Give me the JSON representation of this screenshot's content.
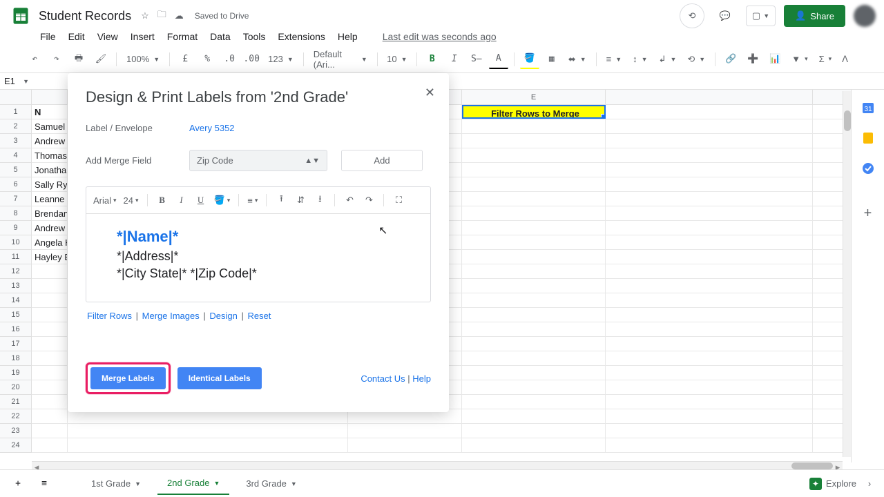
{
  "header": {
    "doc_title": "Student Records",
    "saved": "Saved to Drive",
    "share": "Share"
  },
  "menu": {
    "items": [
      "File",
      "Edit",
      "View",
      "Insert",
      "Format",
      "Data",
      "Tools",
      "Extensions",
      "Help"
    ],
    "last_edit": "Last edit was seconds ago"
  },
  "toolbar": {
    "zoom": "100%",
    "font": "Default (Ari...",
    "font_size": "10"
  },
  "namebox": "E1",
  "columns": {
    "E": "E"
  },
  "rows": {
    "names": [
      "Samuel",
      "Andrew",
      "Thomas",
      "Jonatha",
      "Sally Ry",
      "Leanne",
      "Brendan",
      "Andrew",
      "Angela H",
      "Hayley E"
    ]
  },
  "filter_header": "Filter Rows to Merge",
  "dialog": {
    "title": "Design & Print Labels from '2nd Grade'",
    "label_envelope": "Label / Envelope",
    "avery": "Avery 5352",
    "merge_field_label": "Add Merge Field",
    "merge_field_value": "Zip Code",
    "add": "Add",
    "editor": {
      "font": "Arial",
      "size": "24",
      "line1": "*|Name|*",
      "line2": "*|Address|*",
      "line3": "*|City State|* *|Zip Code|*"
    },
    "links": {
      "filter": "Filter Rows",
      "images": "Merge Images",
      "design": "Design",
      "reset": "Reset"
    },
    "merge_labels": "Merge Labels",
    "identical_labels": "Identical Labels",
    "contact": "Contact Us",
    "help": "Help"
  },
  "tabs": {
    "t1": "1st Grade",
    "t2": "2nd Grade",
    "t3": "3rd Grade"
  },
  "explore": "Explore"
}
